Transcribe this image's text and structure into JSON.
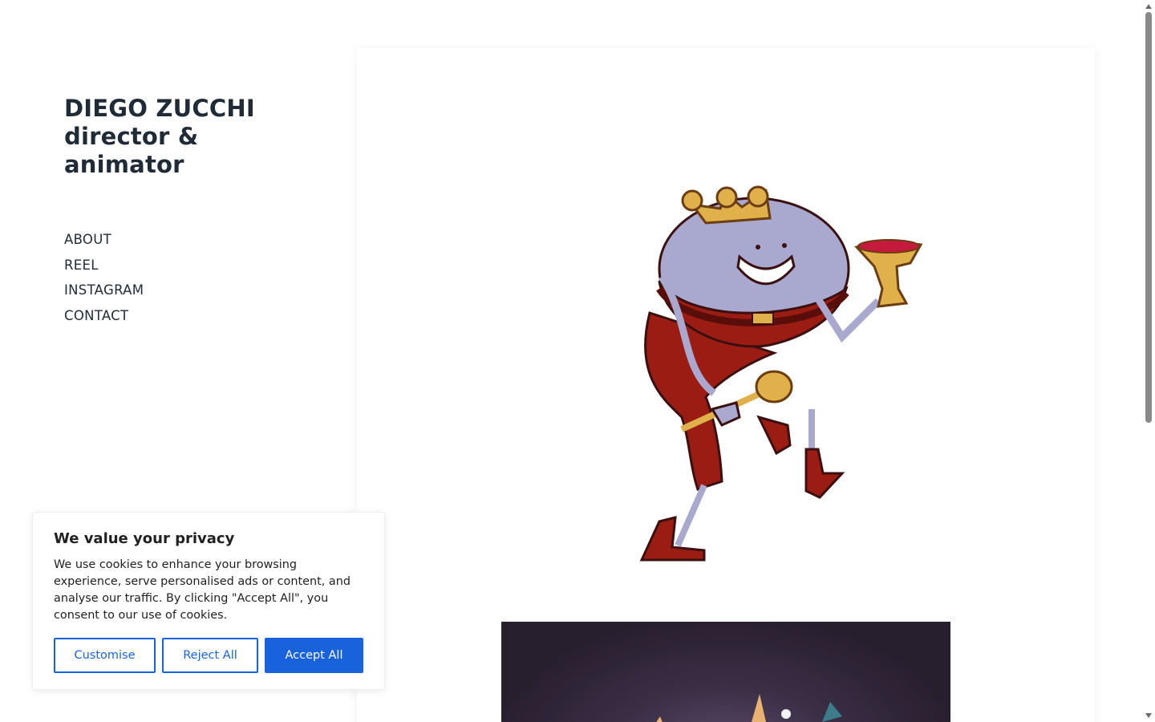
{
  "site": {
    "title_lines": [
      "DIEGO ZUCCHI",
      "director &",
      "animator"
    ]
  },
  "nav": {
    "items": [
      {
        "label": "ABOUT"
      },
      {
        "label": "REEL"
      },
      {
        "label": "INSTAGRAM"
      },
      {
        "label": "CONTACT"
      }
    ]
  },
  "cookie_banner": {
    "title": "We value your privacy",
    "text": "We use cookies to enhance your browsing experience, serve personalised ads or content, and analyse our traffic. By clicking \"Accept All\", you consent to our use of cookies.",
    "customise_label": "Customise",
    "reject_label": "Reject All",
    "accept_label": "Accept All"
  },
  "colors": {
    "accent": "#1863dc",
    "text": "#1f2b37",
    "king_body": "#a9a8cf",
    "king_pants": "#9b1c13",
    "crown_gold": "#e0b04a",
    "dark_panel": "#271e2e"
  },
  "icons": [
    "scroll-up-arrow",
    "scroll-down-arrow"
  ]
}
